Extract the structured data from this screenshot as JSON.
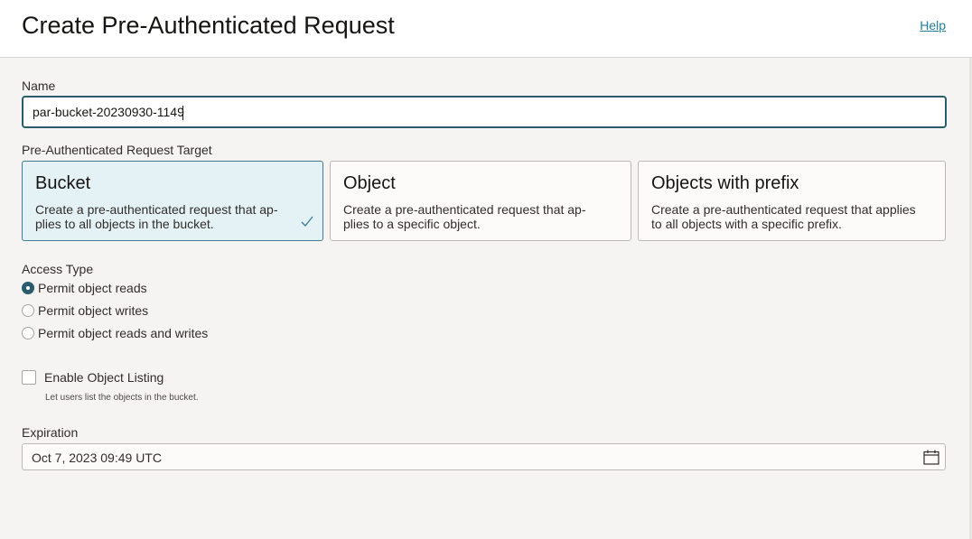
{
  "header": {
    "title": "Create Pre-Authenticated Request",
    "help_label": "Help"
  },
  "name_field": {
    "label": "Name",
    "value": "par-bucket-20230930-1149"
  },
  "target": {
    "label": "Pre-Authenticated Request Target",
    "selected": "Bucket",
    "options": [
      {
        "title": "Bucket",
        "description": "Create a pre-authenticated request that ap- plies to all objects in the bucket."
      },
      {
        "title": "Object",
        "description": "Create a pre-authenticated request that ap- plies to a specific object."
      },
      {
        "title": "Objects with prefix",
        "description": "Create a pre-authenticated request that applies to all objects with a specific prefix."
      }
    ]
  },
  "access_type": {
    "label": "Access Type",
    "selected": "Permit object reads",
    "options": [
      {
        "label": "Permit object reads"
      },
      {
        "label": "Permit object writes"
      },
      {
        "label": "Permit object reads and writes"
      }
    ]
  },
  "object_listing": {
    "label": "Enable Object Listing",
    "helper": "Let users list the objects in the bucket.",
    "checked": false
  },
  "expiration": {
    "label": "Expiration",
    "value": "Oct 7, 2023 09:49 UTC"
  },
  "colors": {
    "accent": "#2b5c6e",
    "link": "#227e9e",
    "selected_card_bg": "#e4f1f5"
  },
  "icons": {
    "check": "check-icon",
    "calendar": "calendar-icon"
  }
}
